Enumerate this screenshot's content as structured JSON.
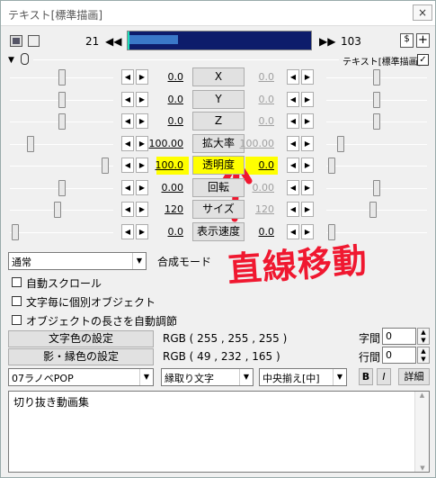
{
  "title": "テキスト[標準描画]",
  "close_label": "×",
  "timeline": {
    "start_frame": "21",
    "end_frame": "103"
  },
  "section_label": "テキスト[標準描画]",
  "params": [
    {
      "name": "X",
      "left": "0.0",
      "right": "0.0",
      "lthumb": 0.5,
      "rthumb": 0.5,
      "right_grey": true
    },
    {
      "name": "Y",
      "left": "0.0",
      "right": "0.0",
      "lthumb": 0.5,
      "rthumb": 0.5,
      "right_grey": true
    },
    {
      "name": "Z",
      "left": "0.0",
      "right": "0.0",
      "lthumb": 0.5,
      "rthumb": 0.5,
      "right_grey": true
    },
    {
      "name": "拡大率",
      "left": "100.00",
      "right": "100.00",
      "lthumb": 0.18,
      "rthumb": 0.12,
      "right_grey": true
    },
    {
      "name": "透明度",
      "left": "100.0",
      "right": "0.0",
      "lthumb": 0.95,
      "rthumb": 0.02,
      "right_grey": false,
      "highlight": true
    },
    {
      "name": "回転",
      "left": "0.00",
      "right": "0.00",
      "lthumb": 0.5,
      "rthumb": 0.5,
      "right_grey": true
    },
    {
      "name": "サイズ",
      "left": "120",
      "right": "120",
      "lthumb": 0.46,
      "rthumb": 0.46,
      "right_grey": true
    },
    {
      "name": "表示速度",
      "left": "0.0",
      "right": "0.0",
      "lthumb": 0.02,
      "rthumb": 0.02,
      "right_grey": false
    }
  ],
  "blend_select": "通常",
  "blend_label": "合成モード",
  "options": [
    {
      "label": "自動スクロール"
    },
    {
      "label": "文字毎に個別オブジェクト"
    },
    {
      "label": "オブジェクトの長さを自動調節"
    }
  ],
  "text_color_button": "文字色の設定",
  "text_color_value": "RGB ( 255 , 255 , 255 )",
  "shadow_color_button": "影・縁色の設定",
  "shadow_color_value": "RGB ( 49 , 232 , 165 )",
  "char_spacing_label": "字間",
  "char_spacing_value": "0",
  "line_spacing_label": "行間",
  "line_spacing_value": "0",
  "font_select": "07ラノベPOP",
  "style_select": "縁取り文字",
  "align_select": "中央揃え[中]",
  "bold_label": "B",
  "italic_label": "I",
  "detail_label": "詳細",
  "text_content": "切り抜き動画集",
  "annotation": "直線移動",
  "colors": {
    "timeline_fill": "#3a78c8",
    "timeline_bg": "#0d1c6b",
    "highlight": "#ffff00",
    "annotation": "#f01830"
  }
}
